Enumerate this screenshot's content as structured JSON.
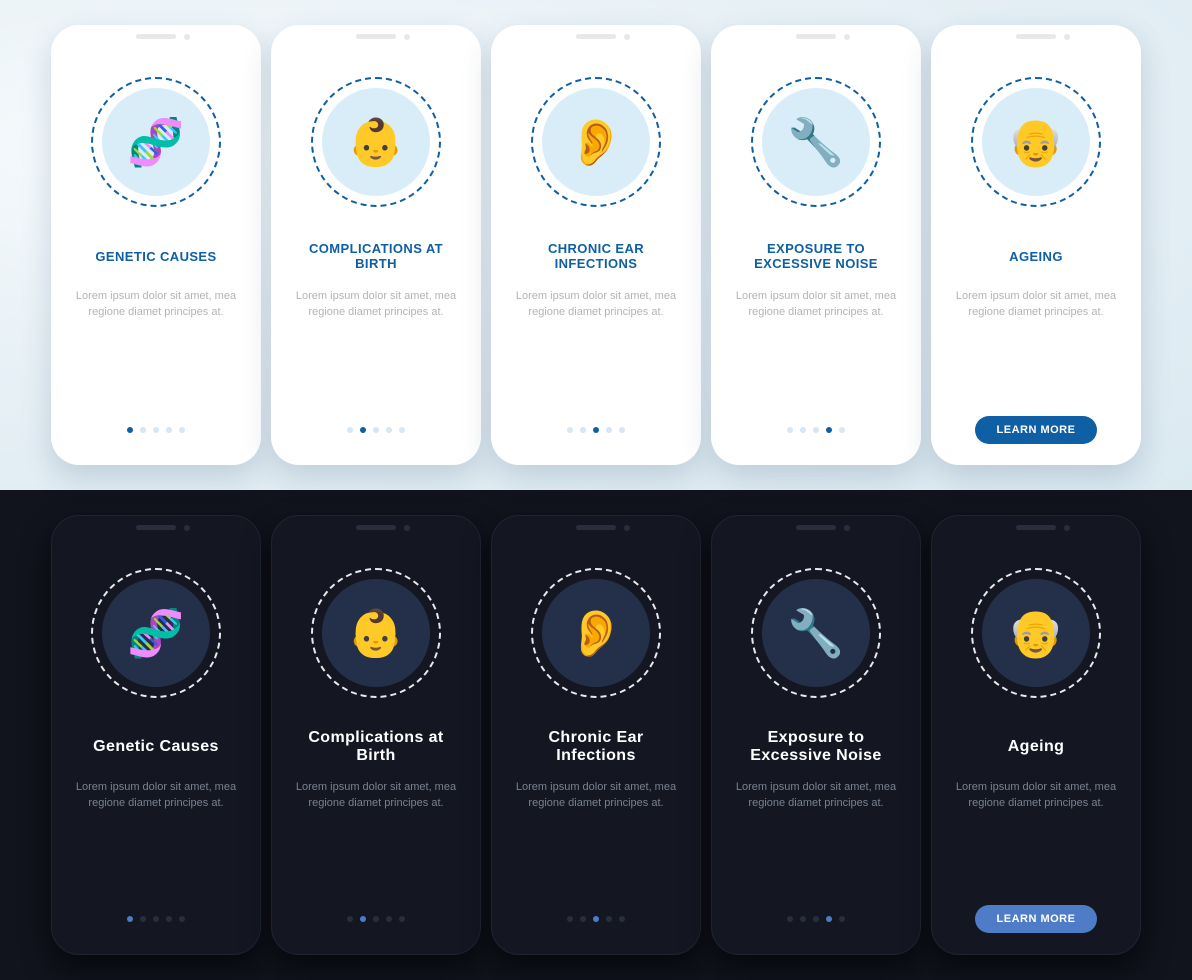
{
  "body_text": "Lorem ipsum dolor sit amet, mea regione diamet principes at.",
  "cta": "LEARN MORE",
  "icons": [
    "🧬",
    "👶",
    "👂",
    "🔧",
    "👴"
  ],
  "light": {
    "cards": [
      {
        "title": "GENETIC CAUSES"
      },
      {
        "title": "COMPLICATIONS AT BIRTH"
      },
      {
        "title": "CHRONIC EAR INFECTIONS"
      },
      {
        "title": "EXPOSURE TO EXCESSIVE NOISE"
      },
      {
        "title": "AGEING"
      }
    ]
  },
  "dark": {
    "cards": [
      {
        "title": "Genetic Causes"
      },
      {
        "title": "Complications at Birth"
      },
      {
        "title": "Chronic Ear Infections"
      },
      {
        "title": "Exposure to Excessive Noise"
      },
      {
        "title": "Ageing"
      }
    ]
  },
  "colors": {
    "accent_light": "#0e5fa4",
    "accent_dark": "#4f7cc7",
    "bg_dark": "#11131d"
  }
}
